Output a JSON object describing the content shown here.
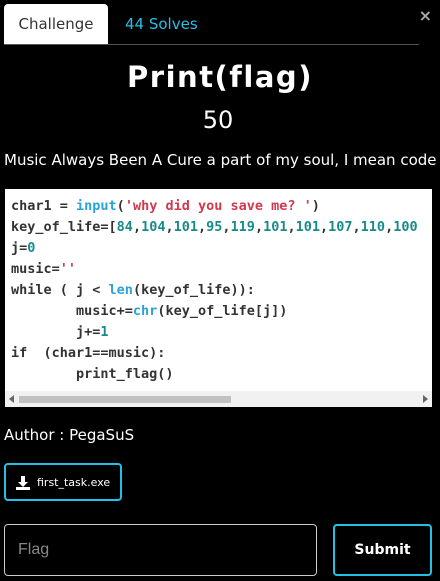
{
  "tabs": {
    "challenge": "Challenge",
    "solves": "44 Solves"
  },
  "close_icon": "×",
  "challenge": {
    "title": "Print(flag)",
    "points": "50",
    "description": "Music Always Been A Cure a part of my soul, I mean code :",
    "author": "Author : PegaSuS"
  },
  "code_lines": [
    "char1 = input('why did you save me? ')",
    "key_of_life=[84,104,101,95,119,101,101,107,110,100",
    "j=0",
    "music=''",
    "while ( j < len(key_of_life)):",
    "        music+=chr(key_of_life[j])",
    "        j+=1",
    "if  (char1==music):",
    "        print_flag()"
  ],
  "file": {
    "name": "first_task.exe",
    "icon": "download-icon"
  },
  "flag_input": {
    "placeholder": "Flag",
    "value": ""
  },
  "submit_label": "Submit",
  "colors": {
    "accent": "#22c1e8",
    "background": "#000000"
  }
}
